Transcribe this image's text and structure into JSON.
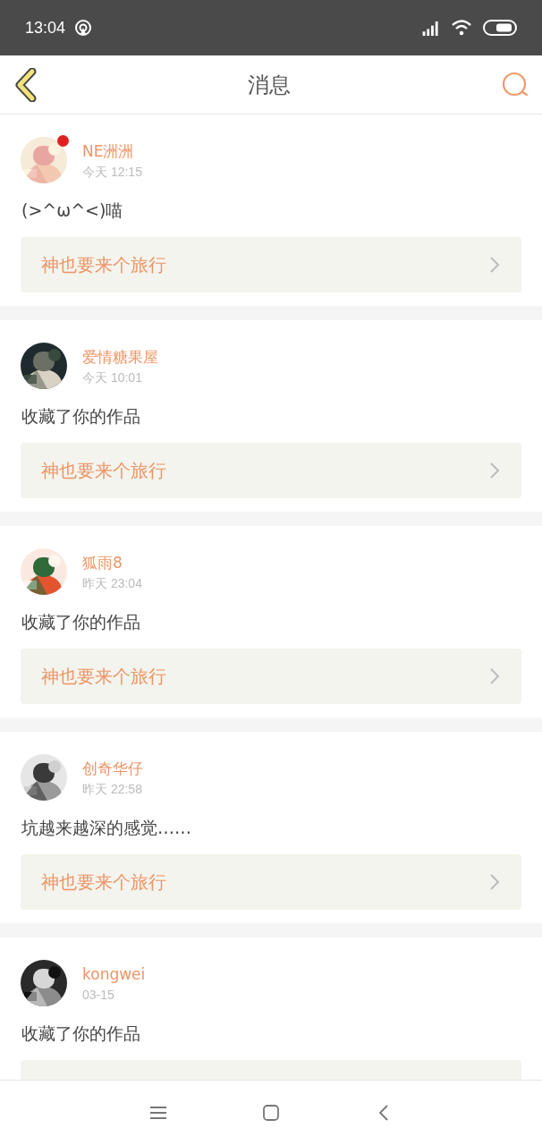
{
  "status_bar": {
    "time": "13:04"
  },
  "header": {
    "title": "消息"
  },
  "messages": [
    {
      "name": "NE洲洲",
      "time": "今天 12:15",
      "unread": true,
      "text": "(>^ω^<)喵",
      "link": "神也要来个旅行"
    },
    {
      "name": "爱情糖果屋",
      "time": "今天 10:01",
      "unread": false,
      "text": "收藏了你的作品",
      "link": "神也要来个旅行"
    },
    {
      "name": "狐雨8",
      "time": "昨天 23:04",
      "unread": false,
      "text": "收藏了你的作品",
      "link": "神也要来个旅行"
    },
    {
      "name": "创奇华仔",
      "time": "昨天 22:58",
      "unread": false,
      "text": "坑越来越深的感觉……",
      "link": "神也要来个旅行"
    },
    {
      "name": "kongwei",
      "time": "03-15",
      "unread": false,
      "text": "收藏了你的作品"
    }
  ]
}
